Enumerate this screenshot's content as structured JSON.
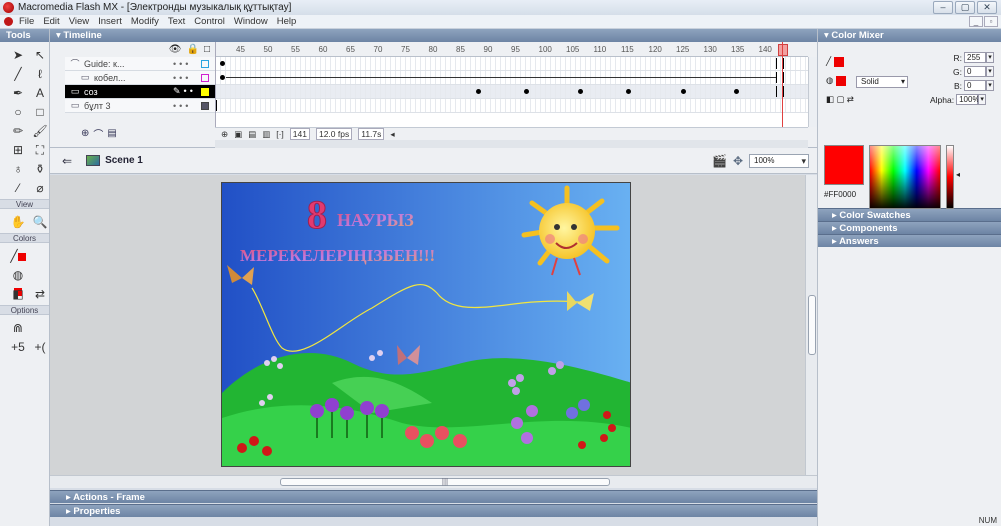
{
  "window": {
    "title": "Macromedia Flash MX - [Электронды музыкалық құттықтау]"
  },
  "menu": [
    "File",
    "Edit",
    "View",
    "Insert",
    "Modify",
    "Text",
    "Control",
    "Window",
    "Help"
  ],
  "tools": {
    "header": "Tools",
    "view_label": "View",
    "colors_label": "Colors",
    "options_label": "Options"
  },
  "timeline": {
    "header": "Timeline",
    "ruler": [
      "45",
      "50",
      "55",
      "60",
      "65",
      "70",
      "75",
      "80",
      "85",
      "90",
      "95",
      "100",
      "105",
      "110",
      "115",
      "120",
      "125",
      "130",
      "135",
      "140"
    ],
    "layers": [
      {
        "name": "Guide: к...",
        "icon": "guide"
      },
      {
        "name": "кобел...",
        "icon": "guided"
      },
      {
        "name": "соз",
        "icon": "normal",
        "selected": true
      },
      {
        "name": "бұлт 3",
        "icon": "normal"
      }
    ],
    "current_frame": "141",
    "fps": "12.0 fps",
    "time": "11.7s"
  },
  "stage": {
    "scene": "Scene 1",
    "zoom": "100%",
    "movie": {
      "line1": "НАУРЫЗ",
      "line1_numeral": "8",
      "line2": "МЕРЕКЕЛЕРІҢІЗБЕН!!!"
    }
  },
  "panels": {
    "actions": "Actions - Frame",
    "properties": "Properties"
  },
  "color_mixer": {
    "header": "Color Mixer",
    "r": "255",
    "g": "0",
    "b": "0",
    "alpha": "100%",
    "type": "Solid",
    "hex": "#FF0000",
    "r_label": "R:",
    "g_label": "G:",
    "b_label": "B:",
    "alpha_label": "Alpha:"
  },
  "right_panels": [
    "Color Swatches",
    "Components",
    "Answers"
  ],
  "status": "NUM",
  "colors": {
    "panel_head": "#7a8fae",
    "accent_red": "#ff0000"
  }
}
